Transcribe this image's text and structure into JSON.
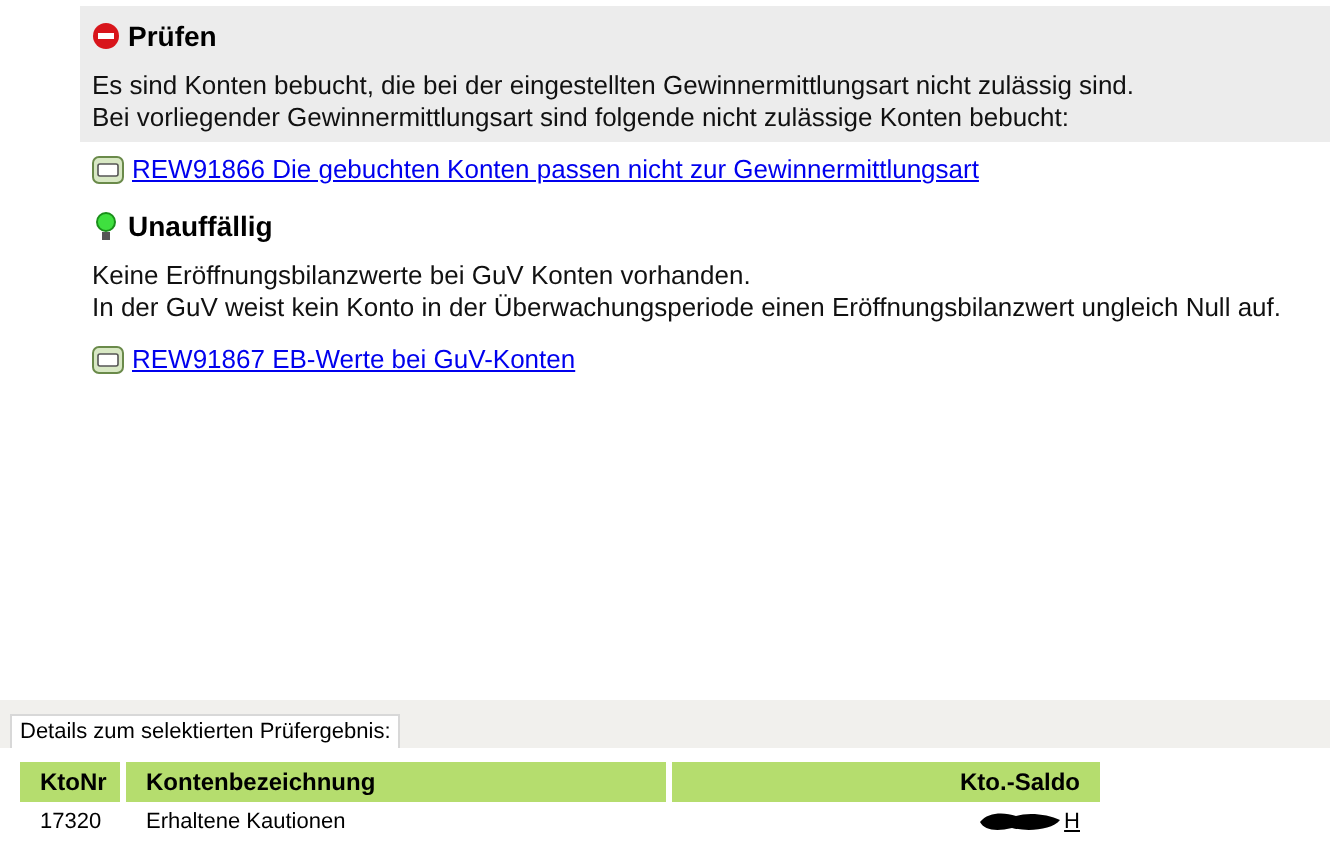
{
  "sections": [
    {
      "kind": "error",
      "title": "Prüfen",
      "lines": [
        "Es sind Konten bebucht, die bei der eingestellten Gewinnermittlungsart nicht zulässig sind.",
        "Bei vorliegender Gewinnermittlungsart sind folgende nicht zulässige Konten bebucht:"
      ],
      "link": "REW91866 Die gebuchten Konten passen nicht zur Gewinnermittlungsart"
    },
    {
      "kind": "ok",
      "title": "Unauffällig",
      "lines": [
        "Keine Eröffnungsbilanzwerte bei GuV Konten vorhanden.",
        "In der GuV weist kein Konto in der Überwachungsperiode einen Eröffnungsbilanzwert ungleich Null auf."
      ],
      "link": "REW91867 EB-Werte bei GuV-Konten"
    }
  ],
  "details": {
    "tab_label": "Details zum selektierten Prüfergebnis:",
    "columns": [
      "KtoNr",
      "Kontenbezeichnung",
      "Kto.-Saldo"
    ],
    "rows": [
      {
        "cells": [
          "17320",
          "Erhaltene Kautionen",
          "H"
        ],
        "redacted": true
      }
    ]
  }
}
